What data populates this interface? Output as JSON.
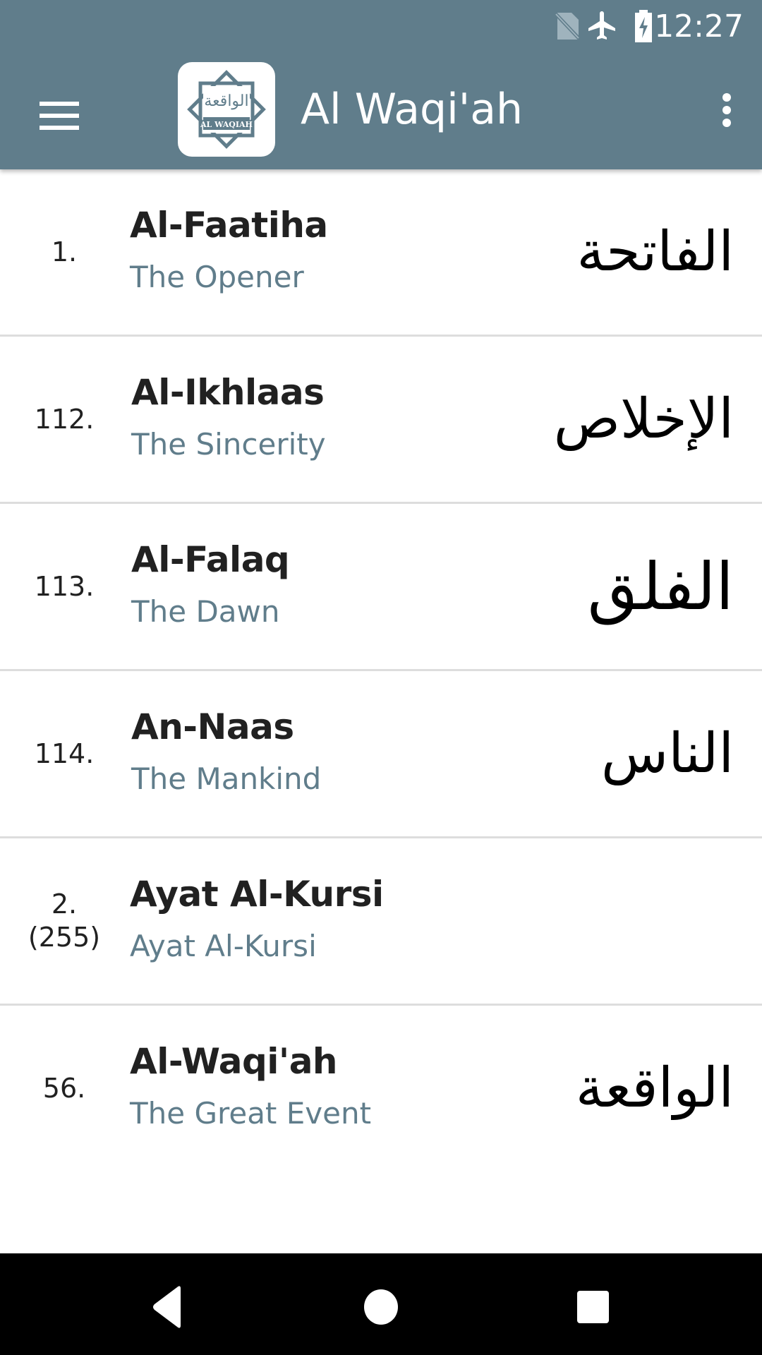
{
  "status_bar": {
    "time": "12:27",
    "icons": [
      "no-sim-icon",
      "airplane-mode-icon",
      "battery-charging-icon"
    ]
  },
  "toolbar": {
    "menu_icon": "hamburger-menu-icon",
    "logo_arabic": "الواقعة",
    "logo_text": "AL WAQIAH",
    "title": "Al Waqi'ah",
    "overflow_icon": "more-vert-icon"
  },
  "surahs": [
    {
      "number": "1.",
      "number_extra": "",
      "name": "Al-Faatiha",
      "translation": "The Opener",
      "arabic": "الفاتحة"
    },
    {
      "number": "112.",
      "number_extra": "",
      "name": "Al-Ikhlaas",
      "translation": "The Sincerity",
      "arabic": "الإخلاص"
    },
    {
      "number": "113.",
      "number_extra": "",
      "name": "Al-Falaq",
      "translation": "The Dawn",
      "arabic": "الفلق"
    },
    {
      "number": "114.",
      "number_extra": "",
      "name": "An-Naas",
      "translation": "The Mankind",
      "arabic": "الناس"
    },
    {
      "number": "2.",
      "number_extra": "(255)",
      "name": "Ayat Al-Kursi",
      "translation": "Ayat Al-Kursi",
      "arabic": ""
    },
    {
      "number": "56.",
      "number_extra": "",
      "name": "Al-Waqi'ah",
      "translation": "The Great Event",
      "arabic": "الواقعة"
    }
  ],
  "nav_bar": {
    "back": "back-icon",
    "home": "home-icon",
    "recents": "recents-icon"
  },
  "colors": {
    "primary": "#607d8b",
    "title_text": "#212121",
    "subtitle_text": "#607d8b",
    "divider": "#dddddd"
  }
}
